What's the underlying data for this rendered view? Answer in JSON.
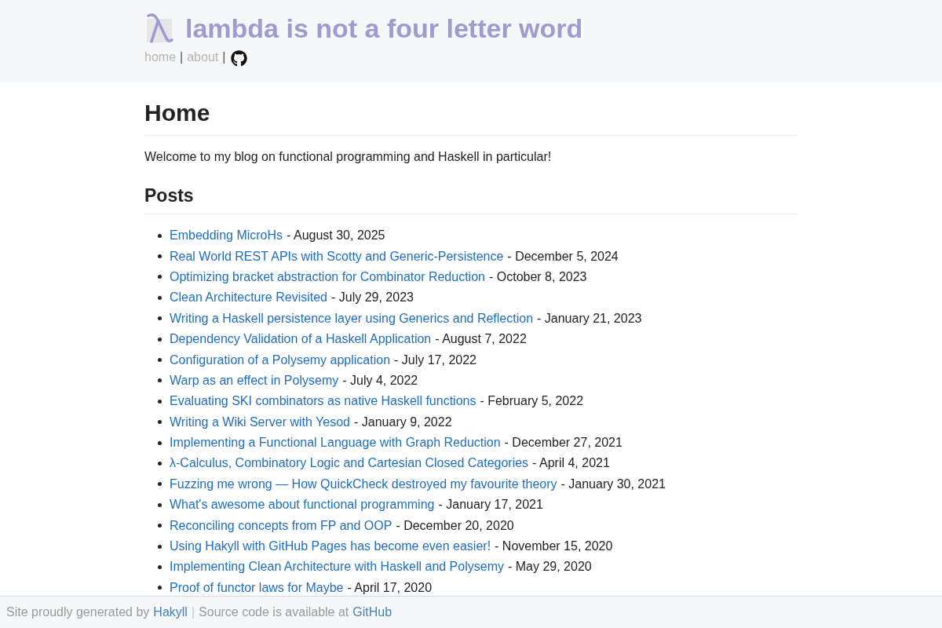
{
  "header": {
    "title": "lambda is not a four letter word",
    "nav": [
      {
        "kind": "link",
        "label": "home"
      },
      {
        "kind": "separator",
        "label": "|"
      },
      {
        "kind": "link",
        "label": "about"
      },
      {
        "kind": "separator",
        "label": "|"
      },
      {
        "kind": "icon_link"
      }
    ]
  },
  "main": {
    "heading": "Home",
    "intro": "Welcome to my blog on functional programming and Haskell in particular!",
    "posts_heading": "Posts",
    "posts": [
      {
        "title": "Embedding MicroHs",
        "suffix": "- August 30, 2025"
      },
      {
        "title": "Real World REST APIs with Scotty and Generic-Persistence",
        "suffix": "- December 5, 2024"
      },
      {
        "title": "Optimizing bracket abstraction for Combinator Reduction",
        "suffix": "- October 8, 2023"
      },
      {
        "title": "Clean Architecture Revisited",
        "suffix": "- July 29, 2023"
      },
      {
        "title": "Writing a Haskell persistence layer using Generics and Reflection",
        "suffix": "- January 21, 2023"
      },
      {
        "title": "Dependency Validation of a Haskell Application",
        "suffix": "- August 7, 2022"
      },
      {
        "title": "Configuration of a Polysemy application",
        "suffix": "- July 17, 2022"
      },
      {
        "title": "Warp as an effect in Polysemy",
        "suffix": "- July 4, 2022"
      },
      {
        "title": "Evaluating SKI combinators as native Haskell functions",
        "suffix": "- February 5, 2022"
      },
      {
        "title": "Writing a Wiki Server with Yesod",
        "suffix": "- January 9, 2022"
      },
      {
        "title": "Implementing a Functional Language with Graph Reduction",
        "suffix": "- December 27, 2021"
      },
      {
        "title": "λ-Calculus, Combinatory Logic and Cartesian Closed Categories",
        "suffix": "- April 4, 2021"
      },
      {
        "title": "Fuzzing me wrong — How QuickCheck destroyed my favourite theory",
        "suffix": "- January 30, 2021"
      },
      {
        "title": "What's awesome about functional programming",
        "suffix": "- January 17, 2021"
      },
      {
        "title": "Reconciling concepts from FP and OOP",
        "suffix": "- December 20, 2020"
      },
      {
        "title": "Using Hakyll with GitHub Pages has become even easier!",
        "suffix": "- November 15, 2020"
      },
      {
        "title": "Implementing Clean Architecture with Haskell and Polysemy",
        "suffix": "- May 29, 2020"
      },
      {
        "title": "Proof of functor laws for Maybe",
        "suffix": "- April 17, 2020"
      }
    ]
  },
  "footer": {
    "parts": [
      {
        "kind": "text",
        "label": "Site proudly generated by"
      },
      {
        "kind": "link",
        "label": "Hakyll"
      },
      {
        "kind": "separator",
        "label": "|"
      },
      {
        "kind": "text",
        "label": "Source code is available at"
      },
      {
        "kind": "link",
        "label": "GitHub"
      }
    ]
  }
}
